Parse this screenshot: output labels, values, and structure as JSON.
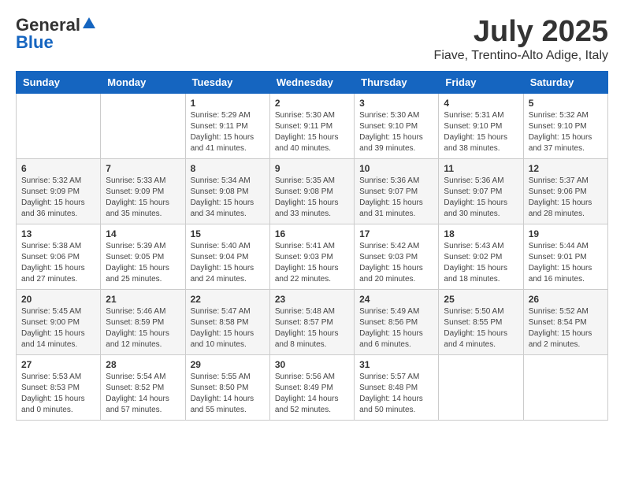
{
  "header": {
    "logo_general": "General",
    "logo_blue": "Blue",
    "month": "July 2025",
    "location": "Fiave, Trentino-Alto Adige, Italy"
  },
  "weekdays": [
    "Sunday",
    "Monday",
    "Tuesday",
    "Wednesday",
    "Thursday",
    "Friday",
    "Saturday"
  ],
  "weeks": [
    [
      {
        "day": "",
        "info": ""
      },
      {
        "day": "",
        "info": ""
      },
      {
        "day": "1",
        "info": "Sunrise: 5:29 AM\nSunset: 9:11 PM\nDaylight: 15 hours\nand 41 minutes."
      },
      {
        "day": "2",
        "info": "Sunrise: 5:30 AM\nSunset: 9:11 PM\nDaylight: 15 hours\nand 40 minutes."
      },
      {
        "day": "3",
        "info": "Sunrise: 5:30 AM\nSunset: 9:10 PM\nDaylight: 15 hours\nand 39 minutes."
      },
      {
        "day": "4",
        "info": "Sunrise: 5:31 AM\nSunset: 9:10 PM\nDaylight: 15 hours\nand 38 minutes."
      },
      {
        "day": "5",
        "info": "Sunrise: 5:32 AM\nSunset: 9:10 PM\nDaylight: 15 hours\nand 37 minutes."
      }
    ],
    [
      {
        "day": "6",
        "info": "Sunrise: 5:32 AM\nSunset: 9:09 PM\nDaylight: 15 hours\nand 36 minutes."
      },
      {
        "day": "7",
        "info": "Sunrise: 5:33 AM\nSunset: 9:09 PM\nDaylight: 15 hours\nand 35 minutes."
      },
      {
        "day": "8",
        "info": "Sunrise: 5:34 AM\nSunset: 9:08 PM\nDaylight: 15 hours\nand 34 minutes."
      },
      {
        "day": "9",
        "info": "Sunrise: 5:35 AM\nSunset: 9:08 PM\nDaylight: 15 hours\nand 33 minutes."
      },
      {
        "day": "10",
        "info": "Sunrise: 5:36 AM\nSunset: 9:07 PM\nDaylight: 15 hours\nand 31 minutes."
      },
      {
        "day": "11",
        "info": "Sunrise: 5:36 AM\nSunset: 9:07 PM\nDaylight: 15 hours\nand 30 minutes."
      },
      {
        "day": "12",
        "info": "Sunrise: 5:37 AM\nSunset: 9:06 PM\nDaylight: 15 hours\nand 28 minutes."
      }
    ],
    [
      {
        "day": "13",
        "info": "Sunrise: 5:38 AM\nSunset: 9:06 PM\nDaylight: 15 hours\nand 27 minutes."
      },
      {
        "day": "14",
        "info": "Sunrise: 5:39 AM\nSunset: 9:05 PM\nDaylight: 15 hours\nand 25 minutes."
      },
      {
        "day": "15",
        "info": "Sunrise: 5:40 AM\nSunset: 9:04 PM\nDaylight: 15 hours\nand 24 minutes."
      },
      {
        "day": "16",
        "info": "Sunrise: 5:41 AM\nSunset: 9:03 PM\nDaylight: 15 hours\nand 22 minutes."
      },
      {
        "day": "17",
        "info": "Sunrise: 5:42 AM\nSunset: 9:03 PM\nDaylight: 15 hours\nand 20 minutes."
      },
      {
        "day": "18",
        "info": "Sunrise: 5:43 AM\nSunset: 9:02 PM\nDaylight: 15 hours\nand 18 minutes."
      },
      {
        "day": "19",
        "info": "Sunrise: 5:44 AM\nSunset: 9:01 PM\nDaylight: 15 hours\nand 16 minutes."
      }
    ],
    [
      {
        "day": "20",
        "info": "Sunrise: 5:45 AM\nSunset: 9:00 PM\nDaylight: 15 hours\nand 14 minutes."
      },
      {
        "day": "21",
        "info": "Sunrise: 5:46 AM\nSunset: 8:59 PM\nDaylight: 15 hours\nand 12 minutes."
      },
      {
        "day": "22",
        "info": "Sunrise: 5:47 AM\nSunset: 8:58 PM\nDaylight: 15 hours\nand 10 minutes."
      },
      {
        "day": "23",
        "info": "Sunrise: 5:48 AM\nSunset: 8:57 PM\nDaylight: 15 hours\nand 8 minutes."
      },
      {
        "day": "24",
        "info": "Sunrise: 5:49 AM\nSunset: 8:56 PM\nDaylight: 15 hours\nand 6 minutes."
      },
      {
        "day": "25",
        "info": "Sunrise: 5:50 AM\nSunset: 8:55 PM\nDaylight: 15 hours\nand 4 minutes."
      },
      {
        "day": "26",
        "info": "Sunrise: 5:52 AM\nSunset: 8:54 PM\nDaylight: 15 hours\nand 2 minutes."
      }
    ],
    [
      {
        "day": "27",
        "info": "Sunrise: 5:53 AM\nSunset: 8:53 PM\nDaylight: 15 hours\nand 0 minutes."
      },
      {
        "day": "28",
        "info": "Sunrise: 5:54 AM\nSunset: 8:52 PM\nDaylight: 14 hours\nand 57 minutes."
      },
      {
        "day": "29",
        "info": "Sunrise: 5:55 AM\nSunset: 8:50 PM\nDaylight: 14 hours\nand 55 minutes."
      },
      {
        "day": "30",
        "info": "Sunrise: 5:56 AM\nSunset: 8:49 PM\nDaylight: 14 hours\nand 52 minutes."
      },
      {
        "day": "31",
        "info": "Sunrise: 5:57 AM\nSunset: 8:48 PM\nDaylight: 14 hours\nand 50 minutes."
      },
      {
        "day": "",
        "info": ""
      },
      {
        "day": "",
        "info": ""
      }
    ]
  ]
}
